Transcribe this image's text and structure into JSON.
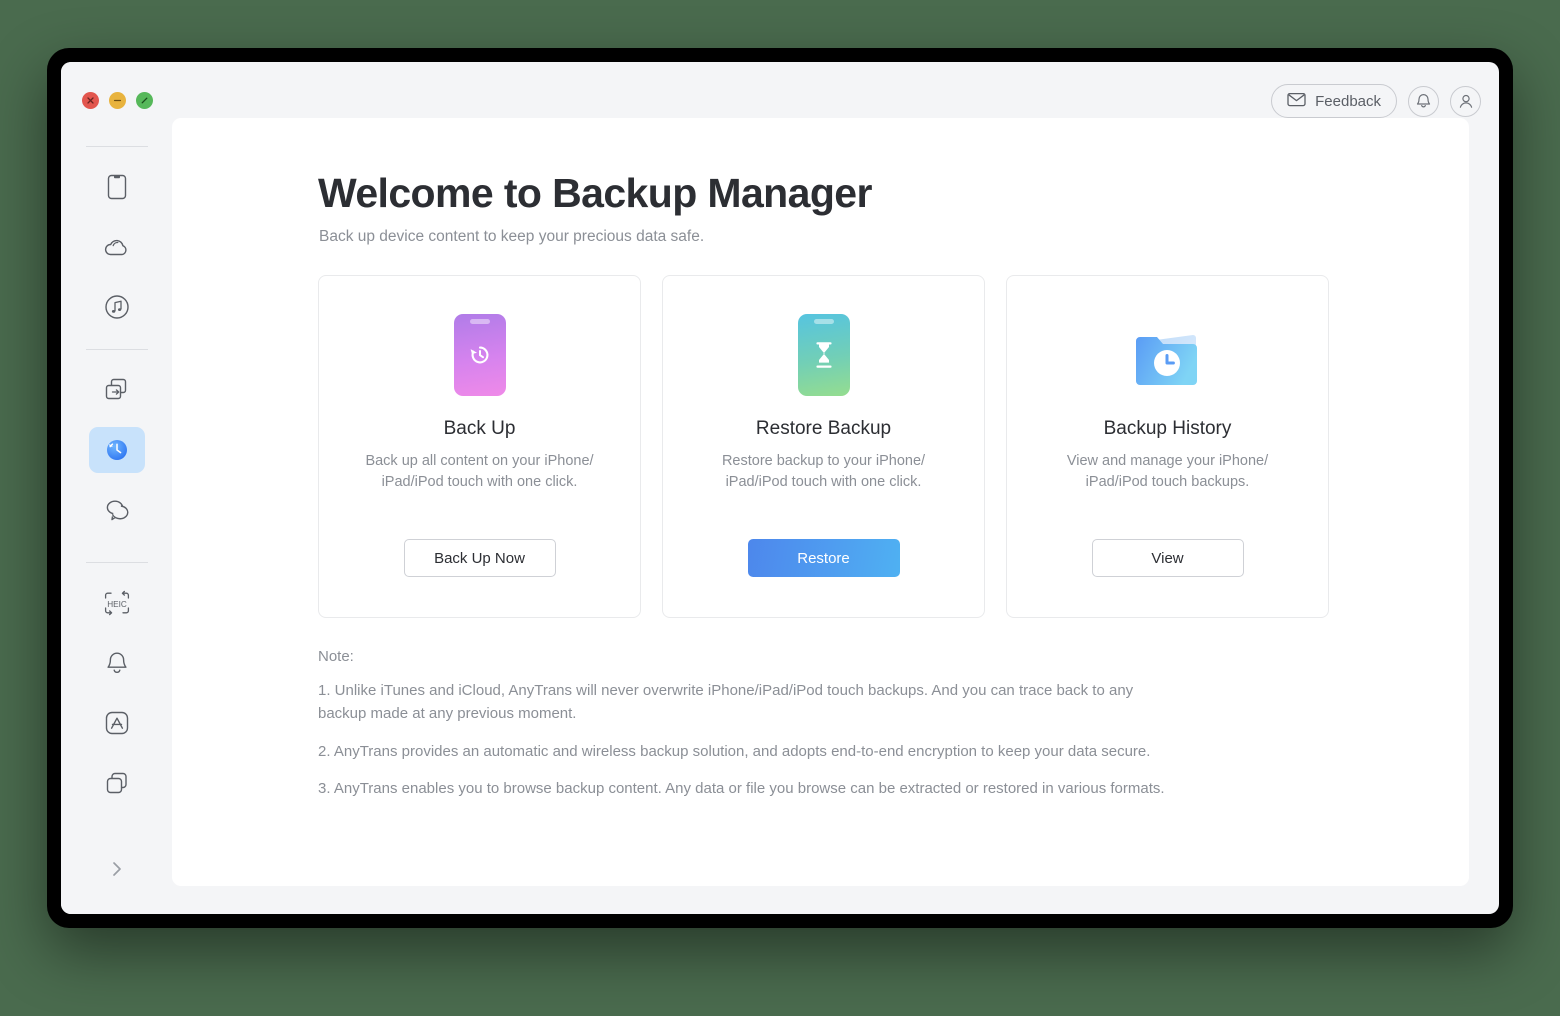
{
  "window": {
    "traffic_lights": [
      {
        "name": "close",
        "color": "#e2564e"
      },
      {
        "name": "minimize",
        "color": "#e8b33e"
      },
      {
        "name": "maximize",
        "color": "#56b85a"
      }
    ]
  },
  "topbar": {
    "feedback_label": "Feedback",
    "feedback_icon": "envelope-icon",
    "notifications_icon": "bell-icon",
    "account_icon": "user-icon"
  },
  "sidebar": {
    "groups": [
      {
        "items": [
          {
            "icon": "device-icon",
            "name": "device",
            "active": false
          },
          {
            "icon": "cloud-icon",
            "name": "cloud",
            "active": false
          },
          {
            "icon": "music-circle-icon",
            "name": "music",
            "active": false
          }
        ]
      },
      {
        "items": [
          {
            "icon": "transfer-icon",
            "name": "transfer",
            "active": false
          },
          {
            "icon": "backup-clock-icon",
            "name": "backup-manager",
            "active": true
          },
          {
            "icon": "messages-icon",
            "name": "messages",
            "active": false
          }
        ]
      },
      {
        "items": [
          {
            "icon": "heic-converter-icon",
            "name": "heic-converter",
            "active": false
          },
          {
            "icon": "bell-icon",
            "name": "ringtone-maker",
            "active": false
          },
          {
            "icon": "app-store-icon",
            "name": "app-downloader",
            "active": false
          },
          {
            "icon": "stack-icon",
            "name": "app-library",
            "active": false
          }
        ]
      }
    ],
    "expand_icon": "chevron-right-icon"
  },
  "main": {
    "title": "Welcome to Backup Manager",
    "subtitle": "Back up device content to keep your precious data safe.",
    "cards": [
      {
        "id": "back-up",
        "art": "phone-history-icon",
        "art_colors": {
          "from": "#b07ce8",
          "to": "#ef8ae8"
        },
        "title": "Back Up",
        "description": "Back up all content on your iPhone/\niPad/iPod touch with one click.",
        "button_label": "Back Up Now",
        "button_style": "outline"
      },
      {
        "id": "restore-backup",
        "art": "phone-hourglass-icon",
        "art_colors": {
          "from": "#56c4e0",
          "to": "#95dd8f"
        },
        "title": "Restore Backup",
        "description": "Restore backup to your iPhone/\niPad/iPod touch with one click.",
        "button_label": "Restore",
        "button_style": "primary"
      },
      {
        "id": "backup-history",
        "art": "folder-clock-icon",
        "art_colors": {
          "from": "#5a9cf5",
          "to": "#7fd4f5"
        },
        "title": "Backup History",
        "description": "View and manage your iPhone/\niPad/iPod touch backups.",
        "button_label": "View",
        "button_style": "outline"
      }
    ],
    "note": {
      "label": "Note:",
      "items": [
        "1. Unlike iTunes and iCloud, AnyTrans will never overwrite iPhone/iPad/iPod touch backups. And you can trace back to any backup made at any previous moment.",
        "2. AnyTrans provides an automatic and wireless backup solution, and adopts end-to-end encryption to keep your data secure.",
        "3. AnyTrans enables you to browse backup content. Any data or file you browse can be extracted or restored in various formats."
      ]
    }
  },
  "colors": {
    "desktop_background": "#4a6b4e",
    "window_background": "#f4f5f7",
    "panel_background": "#ffffff",
    "accent_blue": "#4d87ec",
    "sidebar_active": "#c8e2fb"
  }
}
